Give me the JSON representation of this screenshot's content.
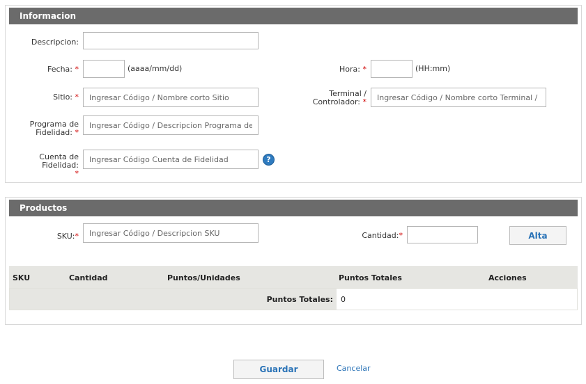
{
  "info_panel": {
    "title": "Informacion",
    "descripcion_label": "Descripcion:",
    "descripcion_value": "",
    "fecha_label": "Fecha:",
    "fecha_hint": "(aaaa/mm/dd)",
    "hora_label": "Hora:",
    "hora_hint": "(HH:mm)",
    "sitio_label": "Sitio:",
    "sitio_placeholder": "Ingresar Código / Nombre corto Sitio",
    "terminal_label_line1": "Terminal /",
    "terminal_label_line2": "Controlador:",
    "terminal_placeholder": "Ingresar Código / Nombre corto Terminal / Controlador",
    "programa_label_line1": "Programa de",
    "programa_label_line2": "Fidelidad:",
    "programa_placeholder": "Ingresar Código / Descripcion Programa de Fidelidad",
    "cuenta_label": "Cuenta de Fidelidad:",
    "cuenta_placeholder": "Ingresar Código Cuenta de Fidelidad",
    "required_mark": "*",
    "help_glyph": "?"
  },
  "products_panel": {
    "title": "Productos",
    "sku_label": "SKU:",
    "sku_placeholder": "Ingresar Código / Descripcion SKU",
    "cantidad_label": "Cantidad:",
    "alta_button": "Alta",
    "table": {
      "columns": [
        "SKU",
        "Cantidad",
        "Puntos/Unidades",
        "Puntos Totales",
        "Acciones"
      ],
      "total_label": "Puntos Totales:",
      "total_value": "0"
    }
  },
  "footer": {
    "save_button": "Guardar",
    "cancel_link": "Cancelar"
  }
}
